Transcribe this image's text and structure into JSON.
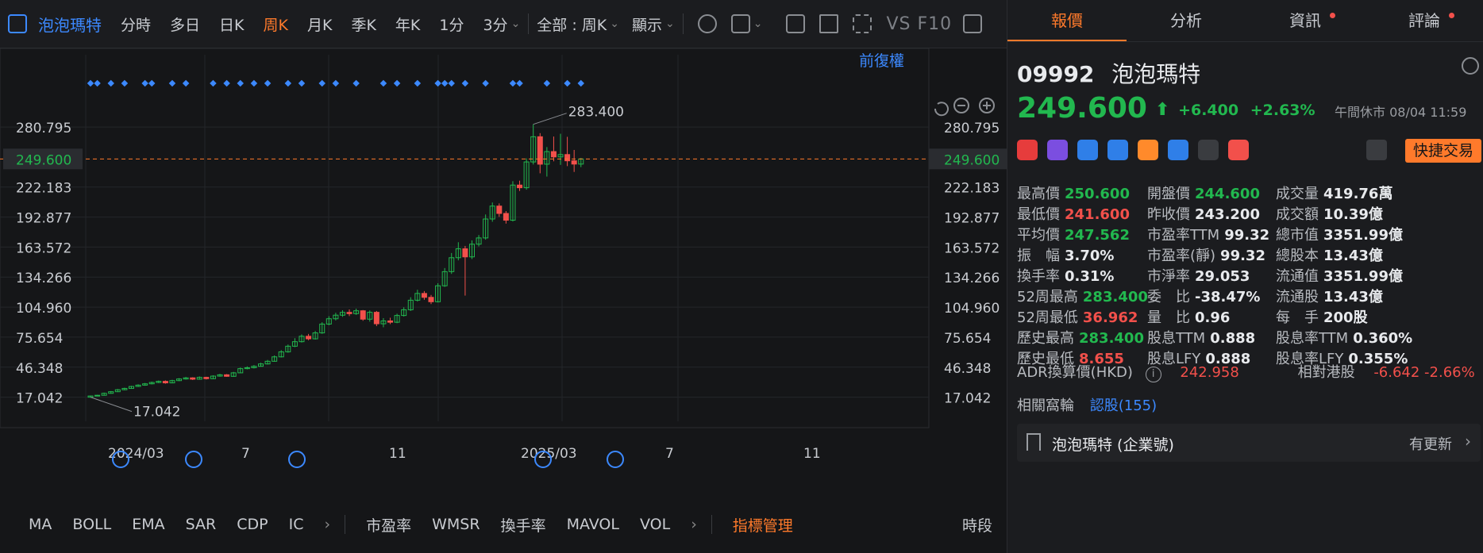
{
  "toolbar": {
    "symbol_name": "泡泡瑪特",
    "timeframes": [
      "分時",
      "多日",
      "日K",
      "周K",
      "月K",
      "季K",
      "年K",
      "1分",
      "3分"
    ],
    "active_timeframe": "周K",
    "range_label": "全部 : 周K",
    "display_label": "顯示",
    "vs_label": "VS",
    "f10_label": "F10"
  },
  "chart": {
    "adjust_label": "前復權",
    "current_price_label": "249.600",
    "high_marker": "283.400",
    "low_marker": "17.042",
    "y_ticks": [
      "280.795",
      "249.600",
      "222.183",
      "192.877",
      "163.572",
      "134.266",
      "104.960",
      "75.654",
      "46.348",
      "17.042"
    ],
    "x_ticks": [
      "2024/03",
      "7",
      "11",
      "2025/03",
      "7",
      "11"
    ]
  },
  "chart_data": {
    "type": "candlestick",
    "ylim": [
      0,
      300
    ],
    "current_price": 249.6,
    "candles": [
      {
        "o": 17.0,
        "c": 18.2,
        "h": 18.6,
        "l": 17.042
      },
      {
        "o": 18.2,
        "c": 18.9,
        "h": 19.3,
        "l": 17.9
      },
      {
        "o": 18.9,
        "c": 20.8,
        "h": 21.5,
        "l": 18.6
      },
      {
        "o": 20.8,
        "c": 22.4,
        "h": 23.0,
        "l": 20.4
      },
      {
        "o": 22.4,
        "c": 24.3,
        "h": 25.0,
        "l": 22.0
      },
      {
        "o": 24.3,
        "c": 25.6,
        "h": 26.3,
        "l": 23.8
      },
      {
        "o": 25.6,
        "c": 27.5,
        "h": 28.1,
        "l": 25.2
      },
      {
        "o": 27.5,
        "c": 28.8,
        "h": 29.6,
        "l": 27.1
      },
      {
        "o": 28.8,
        "c": 30.1,
        "h": 30.9,
        "l": 28.2
      },
      {
        "o": 30.1,
        "c": 31.4,
        "h": 32.2,
        "l": 29.5
      },
      {
        "o": 31.4,
        "c": 32.5,
        "h": 33.3,
        "l": 30.8
      },
      {
        "o": 32.5,
        "c": 31.0,
        "h": 33.4,
        "l": 30.2
      },
      {
        "o": 31.0,
        "c": 33.2,
        "h": 34.0,
        "l": 30.6
      },
      {
        "o": 33.2,
        "c": 34.8,
        "h": 35.6,
        "l": 32.7
      },
      {
        "o": 34.8,
        "c": 35.9,
        "h": 36.8,
        "l": 34.2
      },
      {
        "o": 35.9,
        "c": 34.6,
        "h": 36.5,
        "l": 33.8
      },
      {
        "o": 34.6,
        "c": 36.4,
        "h": 37.3,
        "l": 34.1
      },
      {
        "o": 36.4,
        "c": 35.1,
        "h": 37.0,
        "l": 34.3
      },
      {
        "o": 35.1,
        "c": 37.6,
        "h": 38.4,
        "l": 34.7
      },
      {
        "o": 37.6,
        "c": 38.9,
        "h": 39.8,
        "l": 37.0
      },
      {
        "o": 38.9,
        "c": 37.4,
        "h": 39.6,
        "l": 36.962
      },
      {
        "o": 37.4,
        "c": 40.8,
        "h": 41.7,
        "l": 37.0
      },
      {
        "o": 40.8,
        "c": 44.9,
        "h": 46.0,
        "l": 40.4
      },
      {
        "o": 44.9,
        "c": 45.8,
        "h": 47.1,
        "l": 44.2
      },
      {
        "o": 45.8,
        "c": 47.2,
        "h": 48.3,
        "l": 45.1
      },
      {
        "o": 47.2,
        "c": 49.5,
        "h": 50.6,
        "l": 46.8
      },
      {
        "o": 49.5,
        "c": 52.1,
        "h": 53.4,
        "l": 48.9
      },
      {
        "o": 52.1,
        "c": 56.4,
        "h": 57.8,
        "l": 51.6
      },
      {
        "o": 56.4,
        "c": 61.3,
        "h": 62.9,
        "l": 55.8
      },
      {
        "o": 61.3,
        "c": 66.8,
        "h": 68.4,
        "l": 60.5
      },
      {
        "o": 66.8,
        "c": 71.2,
        "h": 74.6,
        "l": 65.9
      },
      {
        "o": 71.2,
        "c": 76.5,
        "h": 78.3,
        "l": 70.4
      },
      {
        "o": 76.5,
        "c": 74.0,
        "h": 78.8,
        "l": 72.6
      },
      {
        "o": 74.0,
        "c": 79.8,
        "h": 81.6,
        "l": 73.3
      },
      {
        "o": 79.8,
        "c": 88.4,
        "h": 90.2,
        "l": 78.9
      },
      {
        "o": 88.4,
        "c": 93.6,
        "h": 96.1,
        "l": 87.2
      },
      {
        "o": 93.6,
        "c": 97.1,
        "h": 99.4,
        "l": 92.0
      },
      {
        "o": 97.1,
        "c": 99.8,
        "h": 101.9,
        "l": 95.5
      },
      {
        "o": 99.8,
        "c": 98.6,
        "h": 102.7,
        "l": 96.2
      },
      {
        "o": 98.6,
        "c": 101.4,
        "h": 103.5,
        "l": 97.4
      },
      {
        "o": 101.4,
        "c": 93.2,
        "h": 102.1,
        "l": 91.6
      },
      {
        "o": 93.2,
        "c": 99.9,
        "h": 101.7,
        "l": 90.8
      },
      {
        "o": 99.9,
        "c": 88.7,
        "h": 101.2,
        "l": 86.4
      },
      {
        "o": 88.7,
        "c": 91.5,
        "h": 94.2,
        "l": 85.3
      },
      {
        "o": 91.5,
        "c": 90.2,
        "h": 94.6,
        "l": 88.4
      },
      {
        "o": 90.2,
        "c": 96.8,
        "h": 98.5,
        "l": 89.3
      },
      {
        "o": 96.8,
        "c": 102.4,
        "h": 104.8,
        "l": 95.7
      },
      {
        "o": 102.4,
        "c": 111.7,
        "h": 114.6,
        "l": 101.2
      },
      {
        "o": 111.7,
        "c": 118.3,
        "h": 121.9,
        "l": 110.4
      },
      {
        "o": 118.3,
        "c": 114.5,
        "h": 120.6,
        "l": 112.1
      },
      {
        "o": 114.5,
        "c": 110.2,
        "h": 116.8,
        "l": 107.9
      },
      {
        "o": 110.2,
        "c": 125.8,
        "h": 128.3,
        "l": 109.5
      },
      {
        "o": 125.8,
        "c": 139.6,
        "h": 143.1,
        "l": 124.7
      },
      {
        "o": 139.6,
        "c": 153.2,
        "h": 157.8,
        "l": 137.4
      },
      {
        "o": 153.2,
        "c": 161.9,
        "h": 168.3,
        "l": 150.6
      },
      {
        "o": 161.9,
        "c": 154.0,
        "h": 164.7,
        "l": 116.2
      },
      {
        "o": 154.0,
        "c": 166.4,
        "h": 170.1,
        "l": 151.9
      },
      {
        "o": 166.4,
        "c": 172.5,
        "h": 175.3,
        "l": 164.2
      },
      {
        "o": 172.5,
        "c": 191.0,
        "h": 195.4,
        "l": 170.8
      },
      {
        "o": 191.0,
        "c": 203.6,
        "h": 207.1,
        "l": 188.3
      },
      {
        "o": 203.6,
        "c": 196.4,
        "h": 206.2,
        "l": 193.1
      },
      {
        "o": 196.4,
        "c": 189.8,
        "h": 198.7,
        "l": 186.5
      },
      {
        "o": 189.8,
        "c": 224.1,
        "h": 227.9,
        "l": 188.6
      },
      {
        "o": 224.1,
        "c": 221.5,
        "h": 228.4,
        "l": 218.3
      },
      {
        "o": 221.5,
        "c": 246.7,
        "h": 250.2,
        "l": 219.6
      },
      {
        "o": 246.7,
        "c": 271.3,
        "h": 283.4,
        "l": 244.2
      },
      {
        "o": 271.3,
        "c": 244.5,
        "h": 274.8,
        "l": 235.6
      },
      {
        "o": 244.5,
        "c": 256.8,
        "h": 261.2,
        "l": 232.4
      },
      {
        "o": 256.8,
        "c": 251.6,
        "h": 271.5,
        "l": 247.3
      },
      {
        "o": 251.6,
        "c": 253.9,
        "h": 274.2,
        "l": 243.8
      },
      {
        "o": 253.9,
        "c": 247.8,
        "h": 271.2,
        "l": 242.6
      },
      {
        "o": 247.8,
        "c": 244.6,
        "h": 258.4,
        "l": 236.9
      },
      {
        "o": 244.6,
        "c": 249.6,
        "h": 250.6,
        "l": 241.6
      }
    ]
  },
  "indicators": [
    "MA",
    "BOLL",
    "EMA",
    "SAR",
    "CDP",
    "IC",
    "市盈率",
    "WMSR",
    "換手率",
    "MAVOL",
    "VOL",
    "指標管理",
    "時段"
  ],
  "tabs": [
    "報價",
    "分析",
    "資訊",
    "評論"
  ],
  "quote": {
    "code": "09992",
    "name": "泡泡瑪特",
    "price": "249.600",
    "arrow": "⬆",
    "change": "+6.400",
    "change_pct": "+2.63%",
    "session": "午間休市 08/04 11:59",
    "quick_trade": "快捷交易"
  },
  "stats": [
    {
      "label": "最高價",
      "value": "250.600",
      "color": "g"
    },
    {
      "label": "開盤價",
      "value": "244.600",
      "color": "g"
    },
    {
      "label": "成交量",
      "value": "419.76萬",
      "color": "w"
    },
    {
      "label": "最低價",
      "value": "241.600",
      "color": "r"
    },
    {
      "label": "昨收價",
      "value": "243.200",
      "color": "w"
    },
    {
      "label": "成交額",
      "value": "10.39億",
      "color": "w"
    },
    {
      "label": "平均價",
      "value": "247.562",
      "color": "g"
    },
    {
      "label": "市盈率TTM",
      "value": "99.32",
      "color": "w"
    },
    {
      "label": "總市值",
      "value": "3351.99億",
      "color": "w"
    },
    {
      "label": "振　幅",
      "value": "3.70%",
      "color": "w"
    },
    {
      "label": "市盈率(靜)",
      "value": "99.32",
      "color": "w"
    },
    {
      "label": "總股本",
      "value": "13.43億",
      "color": "w"
    },
    {
      "label": "換手率",
      "value": "0.31%",
      "color": "w"
    },
    {
      "label": "市淨率",
      "value": "29.053",
      "color": "w"
    },
    {
      "label": "流通值",
      "value": "3351.99億",
      "color": "w"
    },
    {
      "label": "52周最高",
      "value": "283.400",
      "color": "g"
    },
    {
      "label": "委　比",
      "value": "-38.47%",
      "color": "w"
    },
    {
      "label": "流通股",
      "value": "13.43億",
      "color": "w"
    },
    {
      "label": "52周最低",
      "value": "36.962",
      "color": "r"
    },
    {
      "label": "量　比",
      "value": "0.96",
      "color": "w"
    },
    {
      "label": "每　手",
      "value": "200股",
      "color": "w"
    },
    {
      "label": "歷史最高",
      "value": "283.400",
      "color": "g"
    },
    {
      "label": "股息TTM",
      "value": "0.888",
      "color": "w"
    },
    {
      "label": "股息率TTM",
      "value": "0.360%",
      "color": "w"
    },
    {
      "label": "歷史最低",
      "value": "8.655",
      "color": "r"
    },
    {
      "label": "股息LFY",
      "value": "0.888",
      "color": "w"
    },
    {
      "label": "股息率LFY",
      "value": "0.355%",
      "color": "w"
    }
  ],
  "adr": {
    "label": "ADR換算價(HKD)",
    "value": "242.958",
    "rel_label": "相對港股",
    "rel_value": "-6.642 -2.66%"
  },
  "warrants": {
    "label": "相關窩輪",
    "value": "認股(155)"
  },
  "company": {
    "name": "泡泡瑪特 (企業號)",
    "update": "有更新"
  },
  "colors": {
    "up": "#22b84f",
    "down": "#f2504b",
    "accent": "#ff7a2b",
    "link": "#3c89ff"
  }
}
